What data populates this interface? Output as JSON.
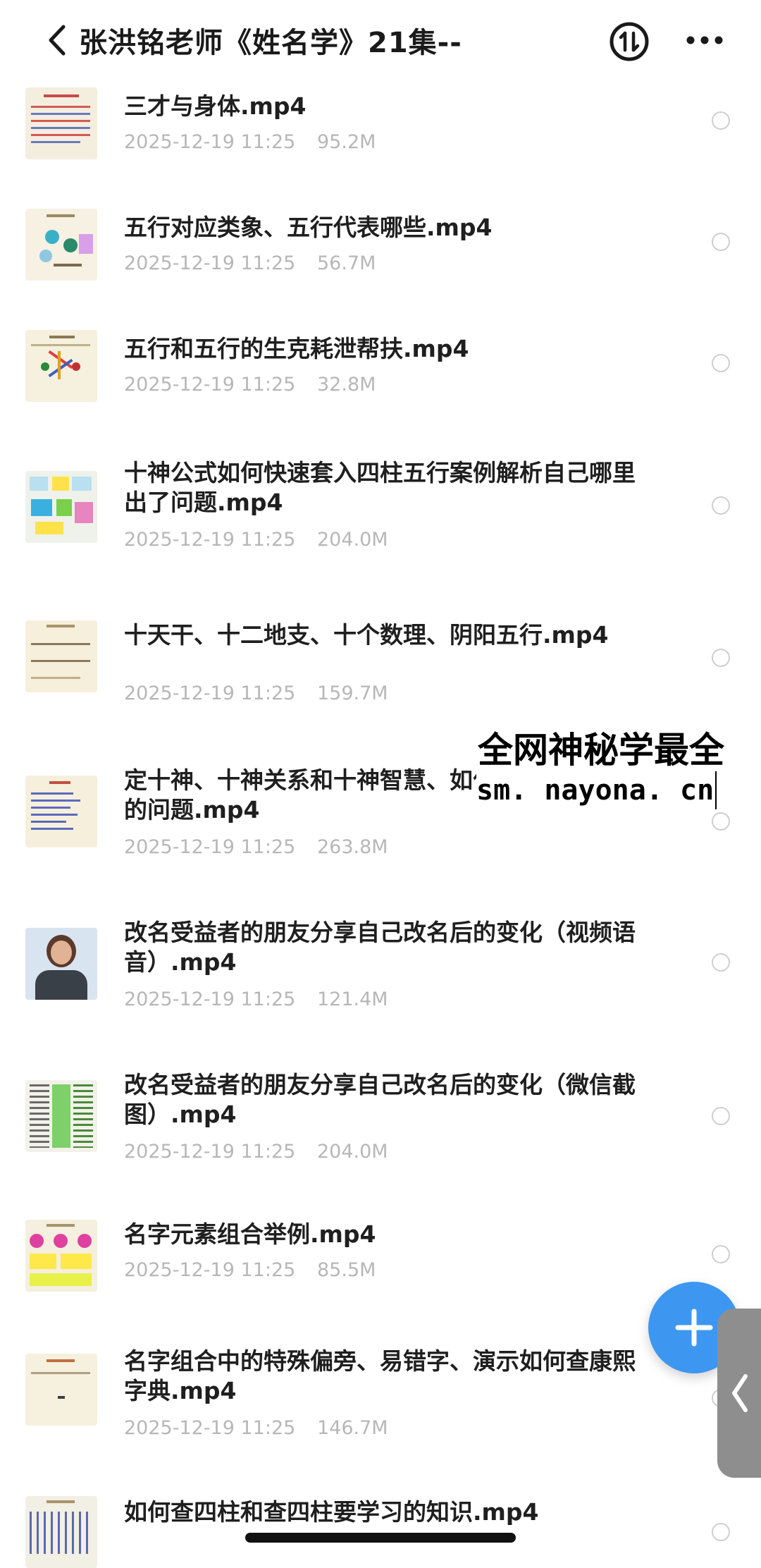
{
  "header": {
    "title": "张洪铭老师《姓名学》21集--"
  },
  "files": [
    {
      "name": "三才与身体.mp4",
      "date": "2025-12-19 11:25",
      "size": "95.2M",
      "thumb": "doc-red"
    },
    {
      "name": "五行对应类象、五行代表哪些.mp4",
      "date": "2025-12-19 11:25",
      "size": "56.7M",
      "thumb": "diagram-teal"
    },
    {
      "name": "五行和五行的生克耗泄帮扶.mp4",
      "date": "2025-12-19 11:25",
      "size": "32.8M",
      "thumb": "diagram-star"
    },
    {
      "name": "十神公式如何快速套入四柱五行案例解析自己哪里出了问题.mp4",
      "date": "2025-12-19 11:25",
      "size": "204.0M",
      "thumb": "diagram-color"
    },
    {
      "name": "十天干、十二地支、十个数理、阴阳五行.mp4",
      "date": "2025-12-19 11:25",
      "size": "159.7M",
      "thumb": "table-plain"
    },
    {
      "name": "定十神、十神关系和十神智慧、如何灵活解决自己的问题.mp4",
      "date": "2025-12-19 11:25",
      "size": "263.8M",
      "thumb": "doc-blue"
    },
    {
      "name": "改名受益者的朋友分享自己改名后的变化（视频语音）.mp4",
      "date": "2025-12-19 11:25",
      "size": "121.4M",
      "thumb": "person"
    },
    {
      "name": "改名受益者的朋友分享自己改名后的变化（微信截图）.mp4",
      "date": "2025-12-19 11:25",
      "size": "204.0M",
      "thumb": "chat-green"
    },
    {
      "name": "名字元素组合举例.mp4",
      "date": "2025-12-19 11:25",
      "size": "85.5M",
      "thumb": "diagram-pink"
    },
    {
      "name": "名字组合中的特殊偏旁、易错字、演示如何查康熙字典.mp4",
      "date": "2025-12-19 11:25",
      "size": "146.7M",
      "thumb": "doc-plain"
    },
    {
      "name": "如何查四柱和查四柱要学习的知识.mp4",
      "date": "",
      "size": "",
      "thumb": "table-dense"
    }
  ],
  "watermark": {
    "line1": "全网神秘学最全",
    "line2": "sm. nayona. cn"
  },
  "icons": {
    "back": "chevron-left-icon",
    "sort": "sort-arrows-icon",
    "more": "more-dots-icon",
    "fab": "plus-icon",
    "side": "chevron-left-icon"
  },
  "colors": {
    "fab": "#3d97f0",
    "meta": "#b7b7b7",
    "title": "#1a1a1a"
  }
}
